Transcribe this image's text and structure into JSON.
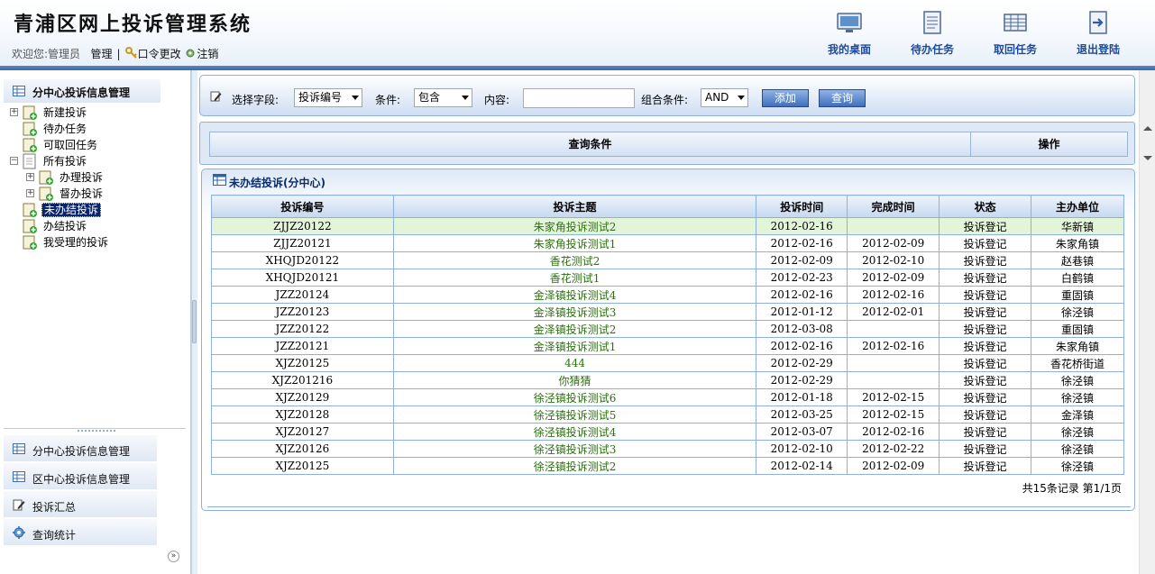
{
  "header": {
    "title": "青浦区网上投诉管理系统",
    "welcome_label": "欢迎您:",
    "user_role": "管理员",
    "user_name": "管理",
    "change_password": "口令更改",
    "logout": "注销",
    "nav": [
      {
        "label": "我的桌面",
        "icon": "monitor-icon"
      },
      {
        "label": "待办任务",
        "icon": "document-icon"
      },
      {
        "label": "取回任务",
        "icon": "table-icon"
      },
      {
        "label": "退出登陆",
        "icon": "exit-icon"
      }
    ]
  },
  "sidebar": {
    "title": "分中心投诉信息管理",
    "tree": [
      {
        "label": "新建投诉"
      },
      {
        "label": "待办任务"
      },
      {
        "label": "可取回任务"
      },
      {
        "label": "所有投诉"
      },
      {
        "label": "办理投诉"
      },
      {
        "label": "督办投诉"
      },
      {
        "label": "未办结投诉",
        "selected": true
      },
      {
        "label": "办结投诉"
      },
      {
        "label": "我受理的投诉"
      }
    ],
    "accordion": [
      {
        "label": "分中心投诉信息管理",
        "icon": "grid-icon"
      },
      {
        "label": "区中心投诉信息管理",
        "icon": "grid-icon"
      },
      {
        "label": "投诉汇总",
        "icon": "edit-icon"
      },
      {
        "label": "查询统计",
        "icon": "gear-icon"
      }
    ]
  },
  "query": {
    "field_label": "选择字段:",
    "field_value": "投诉编号",
    "condition_label": "条件:",
    "condition_value": "包含",
    "content_label": "内容:",
    "content_value": "",
    "combine_label": "组合条件:",
    "combine_value": "AND",
    "add_button": "添加",
    "search_button": "查询"
  },
  "conditions": {
    "col_condition": "查询条件",
    "col_action": "操作"
  },
  "list": {
    "title": "未办结投诉(分中心)",
    "columns": [
      "投诉编号",
      "投诉主题",
      "投诉时间",
      "完成时间",
      "状态",
      "主办单位"
    ],
    "rows": [
      [
        "ZJJZ20122",
        "朱家角投诉测试2",
        "2012-02-16",
        "",
        "投诉登记",
        "华新镇"
      ],
      [
        "ZJJZ20121",
        "朱家角投诉测试1",
        "2012-02-16",
        "2012-02-09",
        "投诉登记",
        "朱家角镇"
      ],
      [
        "XHQJD20122",
        "香花测试2",
        "2012-02-09",
        "2012-02-10",
        "投诉登记",
        "赵巷镇"
      ],
      [
        "XHQJD20121",
        "香花测试1",
        "2012-02-23",
        "2012-02-09",
        "投诉登记",
        "白鹤镇"
      ],
      [
        "JZZ20124",
        "金泽镇投诉测试4",
        "2012-02-16",
        "2012-02-16",
        "投诉登记",
        "重固镇"
      ],
      [
        "JZZ20123",
        "金泽镇投诉测试3",
        "2012-01-12",
        "2012-02-01",
        "投诉登记",
        "徐泾镇"
      ],
      [
        "JZZ20122",
        "金泽镇投诉测试2",
        "2012-03-08",
        "",
        "投诉登记",
        "重固镇"
      ],
      [
        "JZZ20121",
        "金泽镇投诉测试1",
        "2012-02-16",
        "2012-02-16",
        "投诉登记",
        "朱家角镇"
      ],
      [
        "XJZ20125",
        "444",
        "2012-02-29",
        "",
        "投诉登记",
        "香花桥街道"
      ],
      [
        "XJZ201216",
        "你猜猜",
        "2012-02-29",
        "",
        "投诉登记",
        "徐泾镇"
      ],
      [
        "XJZ20129",
        "徐泾镇投诉测试6",
        "2012-01-18",
        "2012-02-15",
        "投诉登记",
        "徐泾镇"
      ],
      [
        "XJZ20128",
        "徐泾镇投诉测试5",
        "2012-03-25",
        "2012-02-15",
        "投诉登记",
        "金泽镇"
      ],
      [
        "XJZ20127",
        "徐泾镇投诉测试4",
        "2012-03-07",
        "2012-02-16",
        "投诉登记",
        "徐泾镇"
      ],
      [
        "XJZ20126",
        "徐泾镇投诉测试3",
        "2012-02-10",
        "2012-02-22",
        "投诉登记",
        "徐泾镇"
      ],
      [
        "XJZ20125",
        "徐泾镇投诉测试2",
        "2012-02-14",
        "2012-02-09",
        "投诉登记",
        "徐泾镇"
      ]
    ],
    "highlighted_row": 0,
    "pager": "共15条记录 第1/1页"
  }
}
